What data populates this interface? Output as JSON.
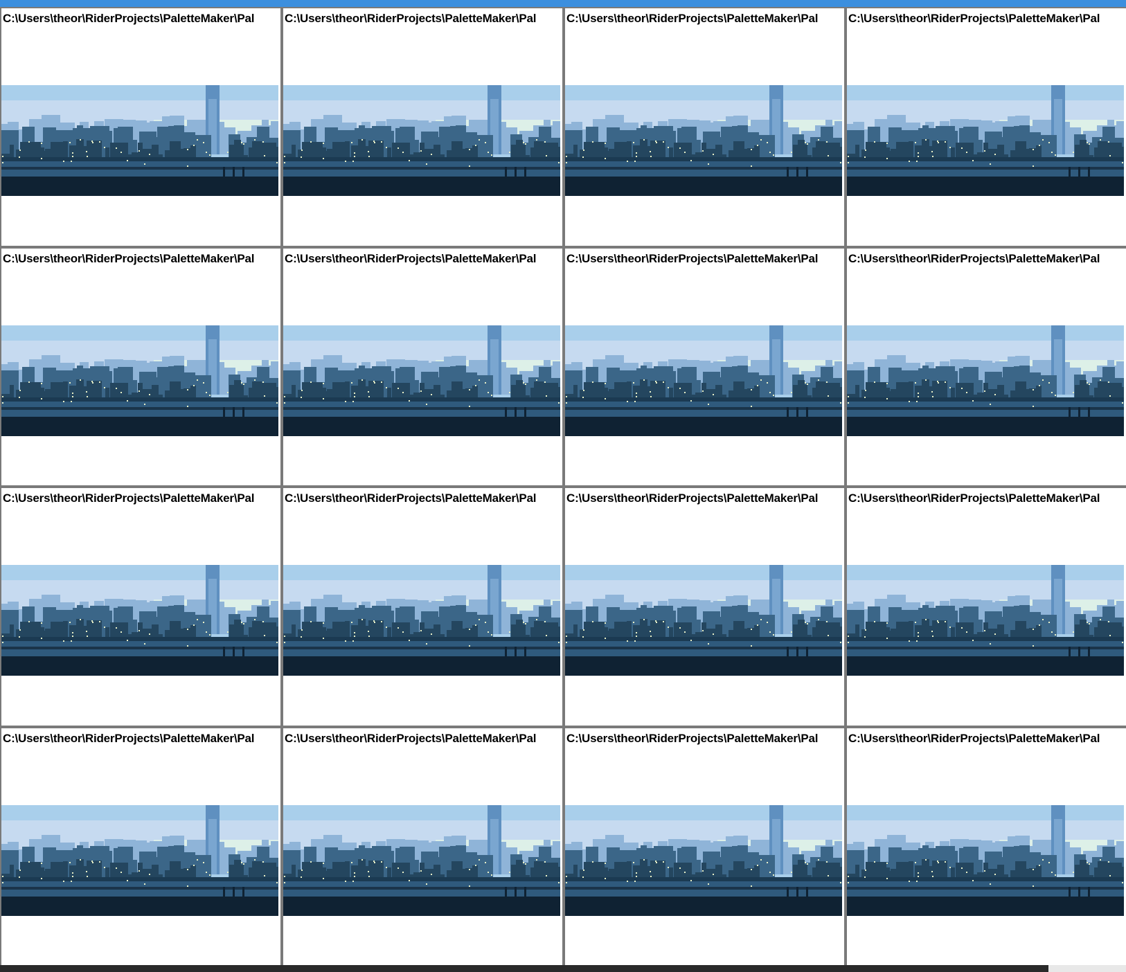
{
  "window": {
    "accent_color": "#3c8fde"
  },
  "tiles": [
    {
      "path": "C:\\Users\\theor\\RiderProjects\\PaletteMaker\\Pal"
    },
    {
      "path": "C:\\Users\\theor\\RiderProjects\\PaletteMaker\\Pal"
    },
    {
      "path": "C:\\Users\\theor\\RiderProjects\\PaletteMaker\\Pal"
    },
    {
      "path": "C:\\Users\\theor\\RiderProjects\\PaletteMaker\\Pal"
    },
    {
      "path": "C:\\Users\\theor\\RiderProjects\\PaletteMaker\\Pal"
    },
    {
      "path": "C:\\Users\\theor\\RiderProjects\\PaletteMaker\\Pal"
    },
    {
      "path": "C:\\Users\\theor\\RiderProjects\\PaletteMaker\\Pal"
    },
    {
      "path": "C:\\Users\\theor\\RiderProjects\\PaletteMaker\\Pal"
    },
    {
      "path": "C:\\Users\\theor\\RiderProjects\\PaletteMaker\\Pal"
    },
    {
      "path": "C:\\Users\\theor\\RiderProjects\\PaletteMaker\\Pal"
    },
    {
      "path": "C:\\Users\\theor\\RiderProjects\\PaletteMaker\\Pal"
    },
    {
      "path": "C:\\Users\\theor\\RiderProjects\\PaletteMaker\\Pal"
    },
    {
      "path": "C:\\Users\\theor\\RiderProjects\\PaletteMaker\\Pal"
    },
    {
      "path": "C:\\Users\\theor\\RiderProjects\\PaletteMaker\\Pal"
    },
    {
      "path": "C:\\Users\\theor\\RiderProjects\\PaletteMaker\\Pal"
    },
    {
      "path": "C:\\Users\\theor\\RiderProjects\\PaletteMaker\\Pal"
    }
  ],
  "scene_palette": {
    "sky_top": "#a9cfeb",
    "sky_haze": "#c6daf0",
    "sky_glow": "#ddf0e8",
    "tower": "#5f90c0",
    "far_buildings": "#8fb4d8",
    "mid_buildings": "#3b6688",
    "near_buildings": "#24465f",
    "rail": "#2f5a7d",
    "ground": "#0f2233"
  }
}
